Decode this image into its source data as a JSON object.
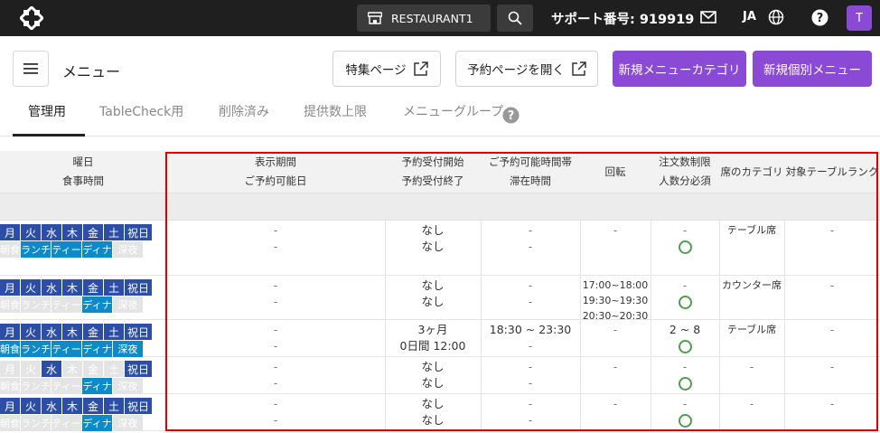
{
  "topbar": {
    "restaurant": "RESTAURANT1",
    "support": "サポート番号: 919919",
    "lang": "JA",
    "avatar": "T"
  },
  "header": {
    "title": "メニュー",
    "feature_page": "特集ページ",
    "open_booking": "予約ページを開く",
    "new_category": "新規メニューカテゴリ",
    "new_item": "新規個別メニュー"
  },
  "tabs": [
    "管理用",
    "TableCheck用",
    "削除済み",
    "提供数上限",
    "メニューグループ"
  ],
  "columns": {
    "day_1": "曜日",
    "day_2": "食事時間",
    "period_1": "表示期間",
    "period_2": "ご予約可能日",
    "accept_1": "予約受付開始",
    "accept_2": "予約受付終了",
    "time_1": "ご予約可能時間帯",
    "time_2": "滞在時間",
    "turn": "回転",
    "limit_1": "注文数制限",
    "limit_2": "人数分必須",
    "seat": "席のカテゴリ",
    "rank": "対象テーブルランク"
  },
  "weekdays": [
    "月",
    "火",
    "水",
    "木",
    "金",
    "土",
    "祝日"
  ],
  "meals": [
    "朝食",
    "ランチ",
    "ティー",
    "ディナ",
    "深夜"
  ],
  "rows": [
    {
      "days_on": [
        true,
        true,
        true,
        true,
        true,
        true,
        true
      ],
      "meals_on": [
        false,
        true,
        true,
        true,
        false
      ],
      "period": [
        "-",
        "-"
      ],
      "accept": [
        "なし",
        "なし"
      ],
      "time": [
        "-",
        "-"
      ],
      "turn": [
        "-"
      ],
      "limit": "-",
      "circle": true,
      "seat": "テーブル席",
      "rank": "-"
    },
    {
      "days_on": [
        true,
        true,
        true,
        true,
        true,
        true,
        true
      ],
      "meals_on": [
        false,
        false,
        false,
        true,
        false
      ],
      "period": [
        "-",
        "-"
      ],
      "accept": [
        "なし",
        "なし"
      ],
      "time": [
        "-",
        "-"
      ],
      "turn": [
        "17:00~18:00",
        "19:30~19:30",
        "20:30~20:30"
      ],
      "limit": "-",
      "circle": true,
      "seat": "カウンター席",
      "rank": "-"
    },
    {
      "days_on": [
        true,
        true,
        true,
        true,
        true,
        true,
        true
      ],
      "meals_on": [
        true,
        true,
        true,
        true,
        true
      ],
      "period": [
        "-",
        "-"
      ],
      "accept": [
        "3ヶ月",
        "0日間 12:00"
      ],
      "time": [
        "18:30 ~ 23:30",
        "-"
      ],
      "turn": [
        "-"
      ],
      "limit": "2 ~ 8",
      "circle": true,
      "seat": "テーブル席",
      "rank": "-"
    },
    {
      "days_on": [
        false,
        false,
        true,
        false,
        false,
        false,
        true
      ],
      "meals_on": [
        false,
        false,
        false,
        true,
        false
      ],
      "period": [
        "-",
        "-"
      ],
      "accept": [
        "なし",
        "なし"
      ],
      "time": [
        "-",
        "-"
      ],
      "turn": [
        "-"
      ],
      "limit": "-",
      "circle": true,
      "seat": "-",
      "rank": "-"
    },
    {
      "days_on": [
        true,
        true,
        true,
        true,
        true,
        true,
        true
      ],
      "meals_on": [
        false,
        false,
        false,
        true,
        false
      ],
      "period": [
        "-",
        "-"
      ],
      "accept": [
        "なし",
        "なし"
      ],
      "time": [
        "-",
        "-"
      ],
      "turn": [
        "-"
      ],
      "limit": "-",
      "circle": true,
      "seat": "-",
      "rank": "-"
    }
  ],
  "colors": {
    "accent": "#8a4ad6",
    "day_on": "#2c4ea6",
    "meal_on": "#0b8bc9",
    "highlight": "#e50000"
  }
}
